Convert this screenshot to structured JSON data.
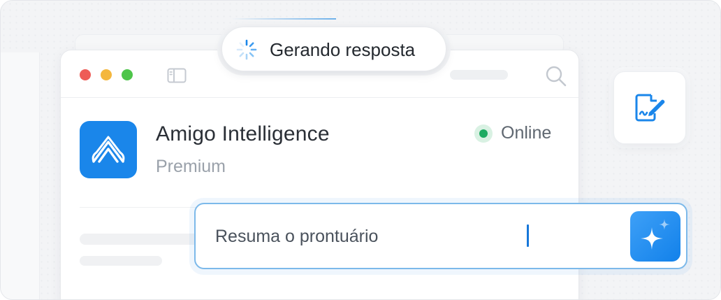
{
  "status_pill": {
    "label": "Gerando resposta",
    "spinner_icon": "spinner-icon"
  },
  "window": {
    "controls": [
      "close",
      "minimize",
      "maximize"
    ],
    "sidebar_toggle_icon": "sidebar-toggle-icon",
    "search_icon": "search-icon"
  },
  "assistant": {
    "name": "Amigo Intelligence",
    "plan": "Premium",
    "logo_icon": "amigo-logo-icon",
    "status": {
      "label": "Online",
      "color": "#1eab62"
    }
  },
  "prompt": {
    "value": "Resuma o prontuário",
    "send_icon": "sparkle-icon"
  },
  "side_card": {
    "icon": "document-edit-icon"
  },
  "colors": {
    "accent": "#1a86ea",
    "input_border": "#7cb9ea"
  }
}
